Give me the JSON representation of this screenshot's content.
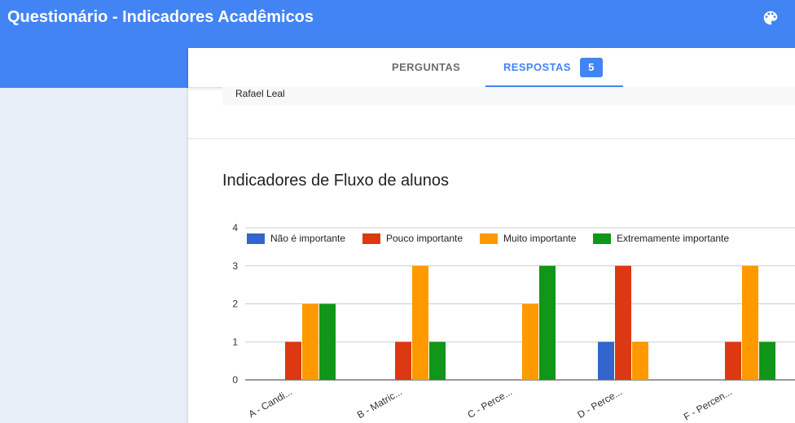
{
  "app": {
    "title": "Questionário - Indicadores Acadêmicos",
    "palette_icon": "palette-icon"
  },
  "tabs": [
    {
      "label": "PERGUNTAS"
    },
    {
      "label": "RESPOSTAS",
      "badge": "5"
    }
  ],
  "response_preview": {
    "name": "Rafael Leal"
  },
  "section": {
    "title": "Indicadores de Fluxo de alunos"
  },
  "colors": {
    "primary": "#4284f3",
    "series": [
      "#3366cc",
      "#dc3912",
      "#ff9900",
      "#109618"
    ]
  },
  "chart_data": {
    "type": "bar",
    "categories": [
      "A - Candi...",
      "B - Matric...",
      "C - Perce...",
      "D - Perce...",
      "F - Percen..."
    ],
    "series": [
      {
        "name": "Não é importante",
        "values": [
          0,
          0,
          0,
          1,
          0
        ]
      },
      {
        "name": "Pouco importante",
        "values": [
          1,
          1,
          0,
          3,
          1
        ]
      },
      {
        "name": "Muito importante",
        "values": [
          2,
          3,
          2,
          1,
          3
        ]
      },
      {
        "name": "Extremamente importante",
        "values": [
          2,
          1,
          3,
          0,
          1
        ]
      }
    ],
    "ylim": [
      0,
      4
    ],
    "yticks": [
      "0",
      "1",
      "2",
      "3",
      "4"
    ],
    "grid": true,
    "legend_position": "top"
  }
}
